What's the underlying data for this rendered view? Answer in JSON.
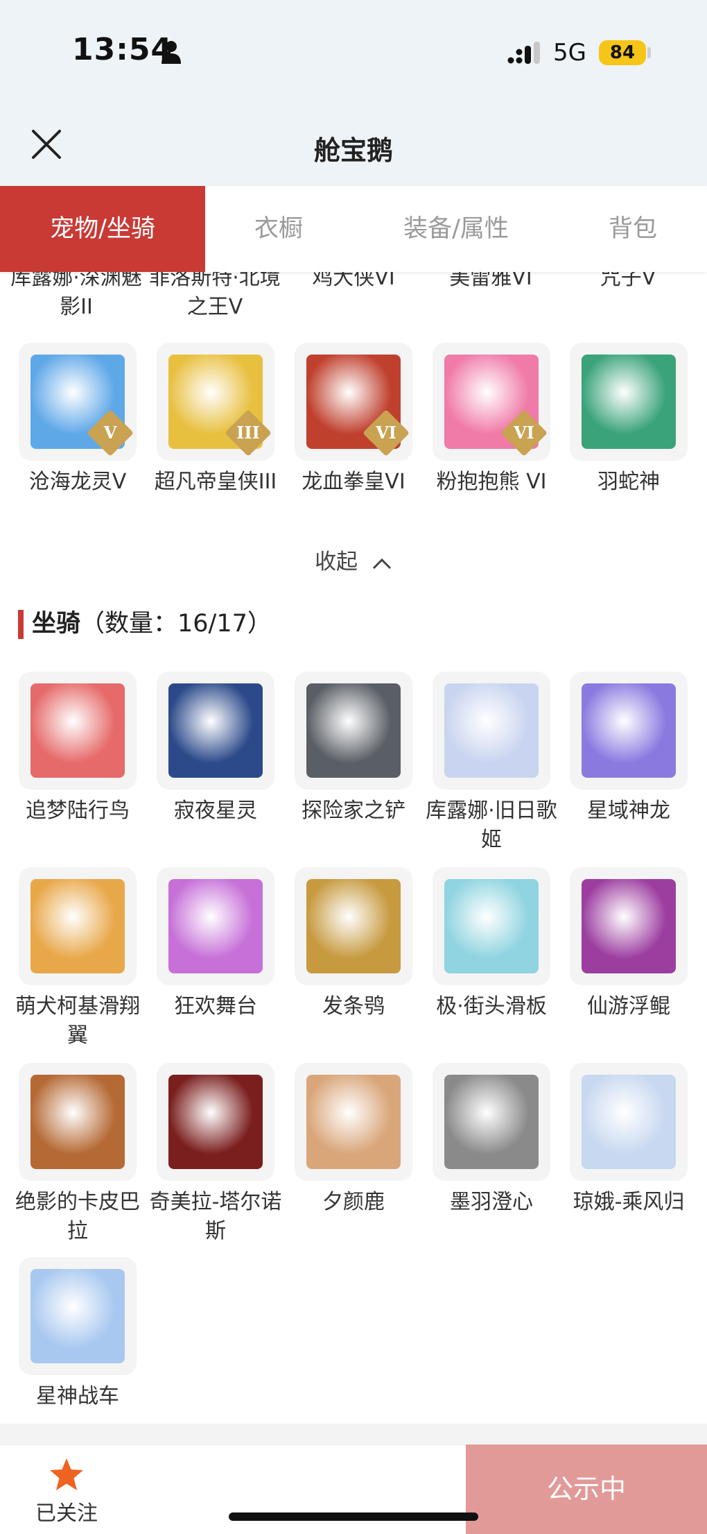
{
  "status_bar": {
    "time": "13:54",
    "network": "5G",
    "battery": "84"
  },
  "header": {
    "title": "舱宝鹅"
  },
  "tabs": [
    {
      "label": "宠物/坐骑",
      "active": true
    },
    {
      "label": "衣橱",
      "active": false
    },
    {
      "label": "装备/属性",
      "active": false
    },
    {
      "label": "背包",
      "active": false
    }
  ],
  "pets_clipped_names": [
    "库露娜·深渊魅影II",
    "菲洛斯特·北境之王V",
    "鸡大侠VI",
    "美雷雅VI",
    "咒子V"
  ],
  "pets_row": [
    {
      "name": "沧海龙灵V",
      "badge": "V",
      "color": "#5fa8e8"
    },
    {
      "name": "超凡帝皇侠III",
      "badge": "III",
      "color": "#e8c040"
    },
    {
      "name": "龙血拳皇VI",
      "badge": "VI",
      "color": "#c0402e"
    },
    {
      "name": "粉抱抱熊 VI",
      "badge": "VI",
      "color": "#f07aa8"
    },
    {
      "name": "羽蛇神",
      "badge": "",
      "color": "#3aa37a"
    }
  ],
  "collapse": {
    "label": "收起"
  },
  "mounts_section": {
    "title": "坐骑",
    "count_label": "（数量：16/17）"
  },
  "mounts": [
    {
      "name": "追梦陆行鸟",
      "color": "#e66a6a"
    },
    {
      "name": "寂夜星灵",
      "color": "#2c4a8a"
    },
    {
      "name": "探险家之铲",
      "color": "#5a5f66"
    },
    {
      "name": "库露娜·旧日歌姬",
      "color": "#c9d4f0"
    },
    {
      "name": "星域神龙",
      "color": "#8a7ae0"
    },
    {
      "name": "萌犬柯基滑翔翼",
      "color": "#e8a84a"
    },
    {
      "name": "狂欢舞台",
      "color": "#c670d8"
    },
    {
      "name": "发条鸮",
      "color": "#c79a40"
    },
    {
      "name": "极·街头滑板",
      "color": "#8fd4e0"
    },
    {
      "name": "仙游浮鲲",
      "color": "#9c3ea0"
    },
    {
      "name": "绝影的卡皮巴拉",
      "color": "#b56a35"
    },
    {
      "name": "奇美拉-塔尔诺斯",
      "color": "#7a1e1e"
    },
    {
      "name": "夕颜鹿",
      "color": "#d9a67a"
    },
    {
      "name": "墨羽澄心",
      "color": "#8a8a8a"
    },
    {
      "name": "琼娥-乘风归",
      "color": "#c8d8f0"
    },
    {
      "name": "星神战车",
      "color": "#a8c8f0"
    }
  ],
  "bottom": {
    "follow_label": "已关注",
    "publish_label": "公示中"
  }
}
